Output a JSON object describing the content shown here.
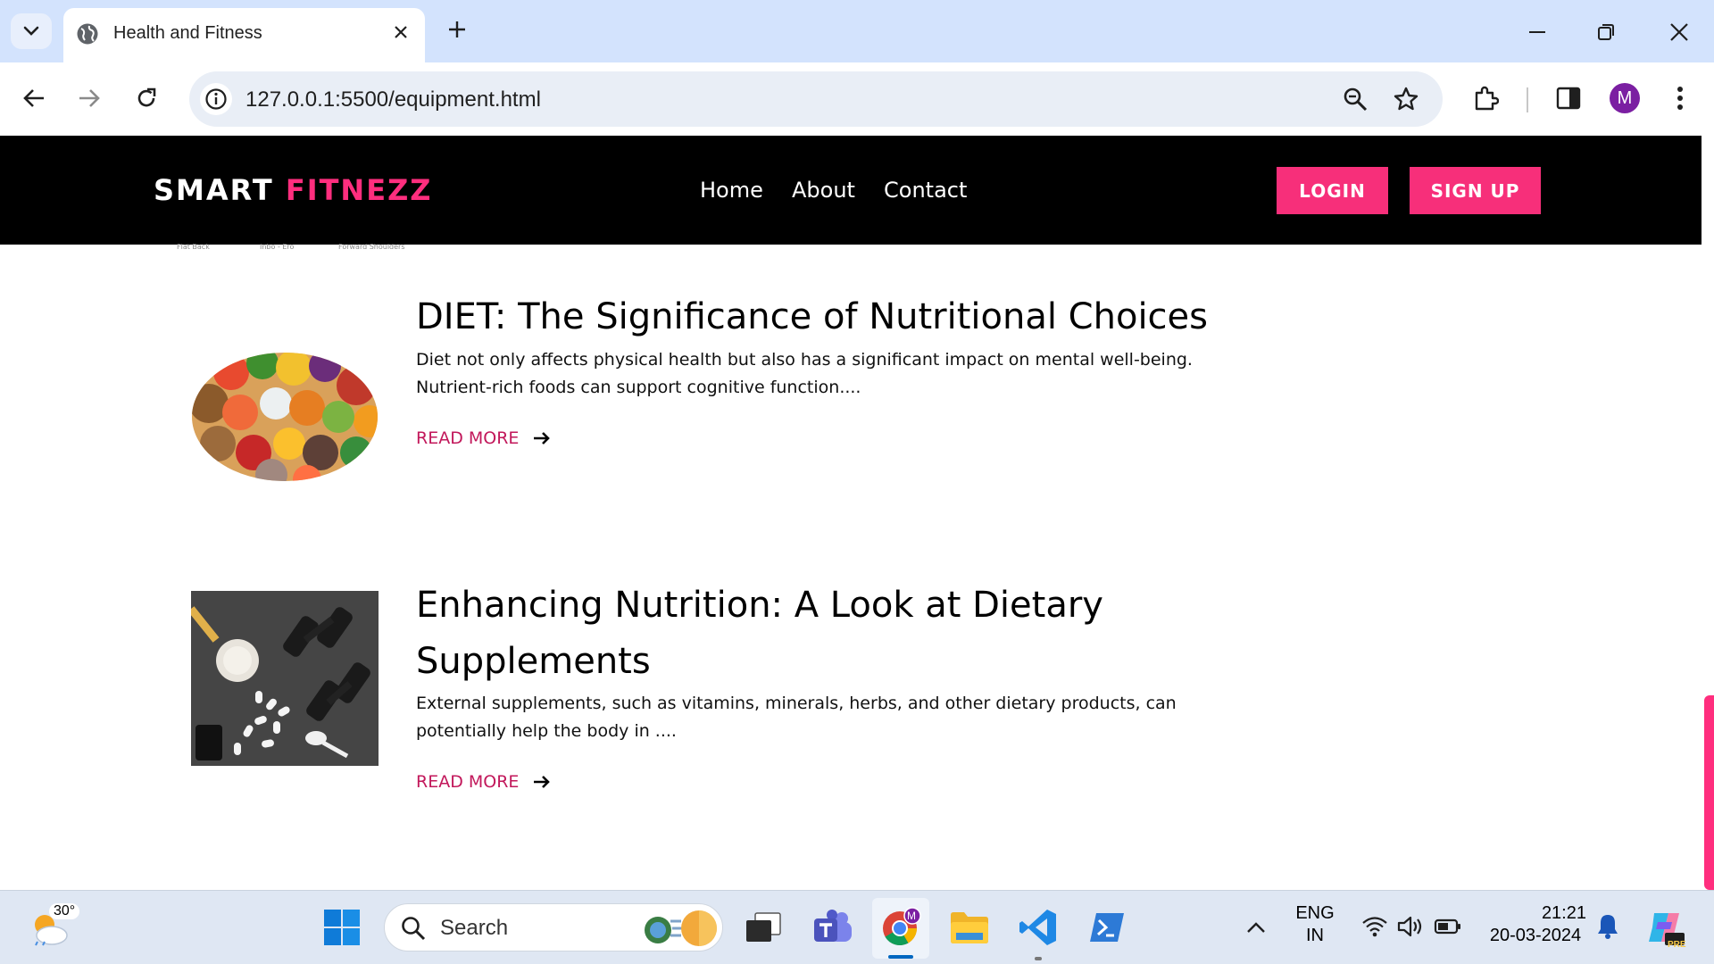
{
  "browser": {
    "tab_title": "Health and Fitness",
    "url": "127.0.0.1:5500/equipment.html",
    "profile_initial": "M"
  },
  "site": {
    "logo_part1": "SMART",
    "logo_part2": "FITNEZZ",
    "nav": [
      "Home",
      "About",
      "Contact"
    ],
    "login_label": "LOGIN",
    "signup_label": "SIGN UP",
    "accent_color": "#f72f7a"
  },
  "scrap_labels": [
    "Flat Back",
    "Inbo - Ero",
    "Forward Shoulders"
  ],
  "articles": [
    {
      "title": "DIET: The Significance of Nutritional Choices",
      "text": "Diet not only affects physical health but also has a significant impact on mental well-being. Nutrient-rich foods can support cognitive function....",
      "read_more": "READ MORE",
      "image": "assorted-healthy-foods-image"
    },
    {
      "title": "Enhancing Nutrition: A Look at Dietary Supplements",
      "text": "External supplements, such as vitamins, minerals, herbs, and other dietary products, can potentially help the body in ....",
      "read_more": "READ MORE",
      "image": "supplements-and-dumbbells-image"
    }
  ],
  "taskbar": {
    "weather_temp": "30°",
    "search_placeholder": "Search",
    "language_line1": "ENG",
    "language_line2": "IN",
    "time": "21:21",
    "date": "20-03-2024",
    "copilot_badge": "PRE",
    "chrome_badge": "M"
  }
}
